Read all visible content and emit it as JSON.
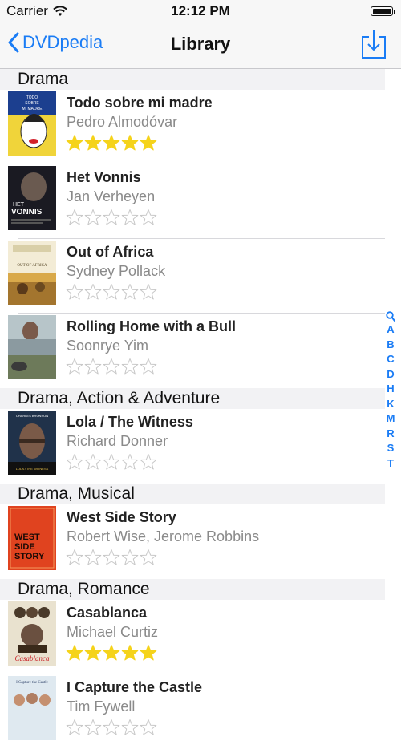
{
  "status": {
    "carrier": "Carrier",
    "time": "12:12 PM"
  },
  "nav": {
    "back_label": "DVDpedia",
    "title": "Library"
  },
  "index_letters": [
    "A",
    "B",
    "C",
    "D",
    "H",
    "K",
    "M",
    "R",
    "S",
    "T"
  ],
  "colors": {
    "accent": "#1a7cf5",
    "star_filled": "#f5d31b",
    "star_empty": "#c7c7c7"
  },
  "sections": [
    {
      "header": "Drama",
      "items": [
        {
          "title": "Todo sobre mi madre",
          "director": "Pedro Almodóvar",
          "rating": 5,
          "cover": "cover-todo"
        },
        {
          "title": "Het Vonnis",
          "director": "Jan Verheyen",
          "rating": 0,
          "cover": "cover-vonnis"
        },
        {
          "title": "Out of Africa",
          "director": "Sydney Pollack",
          "rating": 0,
          "cover": "cover-africa"
        },
        {
          "title": "Rolling Home with a Bull",
          "director": "Soonrye Yim",
          "rating": 0,
          "cover": "cover-rolling"
        }
      ]
    },
    {
      "header": "Drama, Action & Adventure",
      "items": [
        {
          "title": "Lola / The Witness",
          "director": "Richard Donner",
          "rating": 0,
          "cover": "cover-lola"
        }
      ]
    },
    {
      "header": "Drama, Musical",
      "items": [
        {
          "title": "West Side Story",
          "director": "Robert Wise, Jerome Robbins",
          "rating": 0,
          "cover": "cover-westside"
        }
      ]
    },
    {
      "header": "Drama, Romance",
      "items": [
        {
          "title": "Casablanca",
          "director": "Michael Curtiz",
          "rating": 5,
          "cover": "cover-casablanca"
        },
        {
          "title": "I Capture the Castle",
          "director": "Tim Fywell",
          "rating": 0,
          "cover": "cover-castle"
        }
      ]
    }
  ],
  "covers": {
    "todo": {
      "l1": "TODO",
      "l2": "SOBRE",
      "l3": "MI MADRE"
    },
    "vonnis": {
      "l1": "HET",
      "l2": "VONNIS"
    },
    "africa": {
      "l1": "OUT OF AFRICA"
    },
    "lola": {
      "l1": "CHARLES BRONSON",
      "l2": "LOLA / THE WITNESS"
    },
    "westside": {
      "l1": "WEST",
      "l2": "SIDE",
      "l3": "STORY"
    },
    "casablanca": {
      "l1": "Casablanca"
    },
    "castle": {
      "l1": "I Capture the Castle"
    }
  }
}
